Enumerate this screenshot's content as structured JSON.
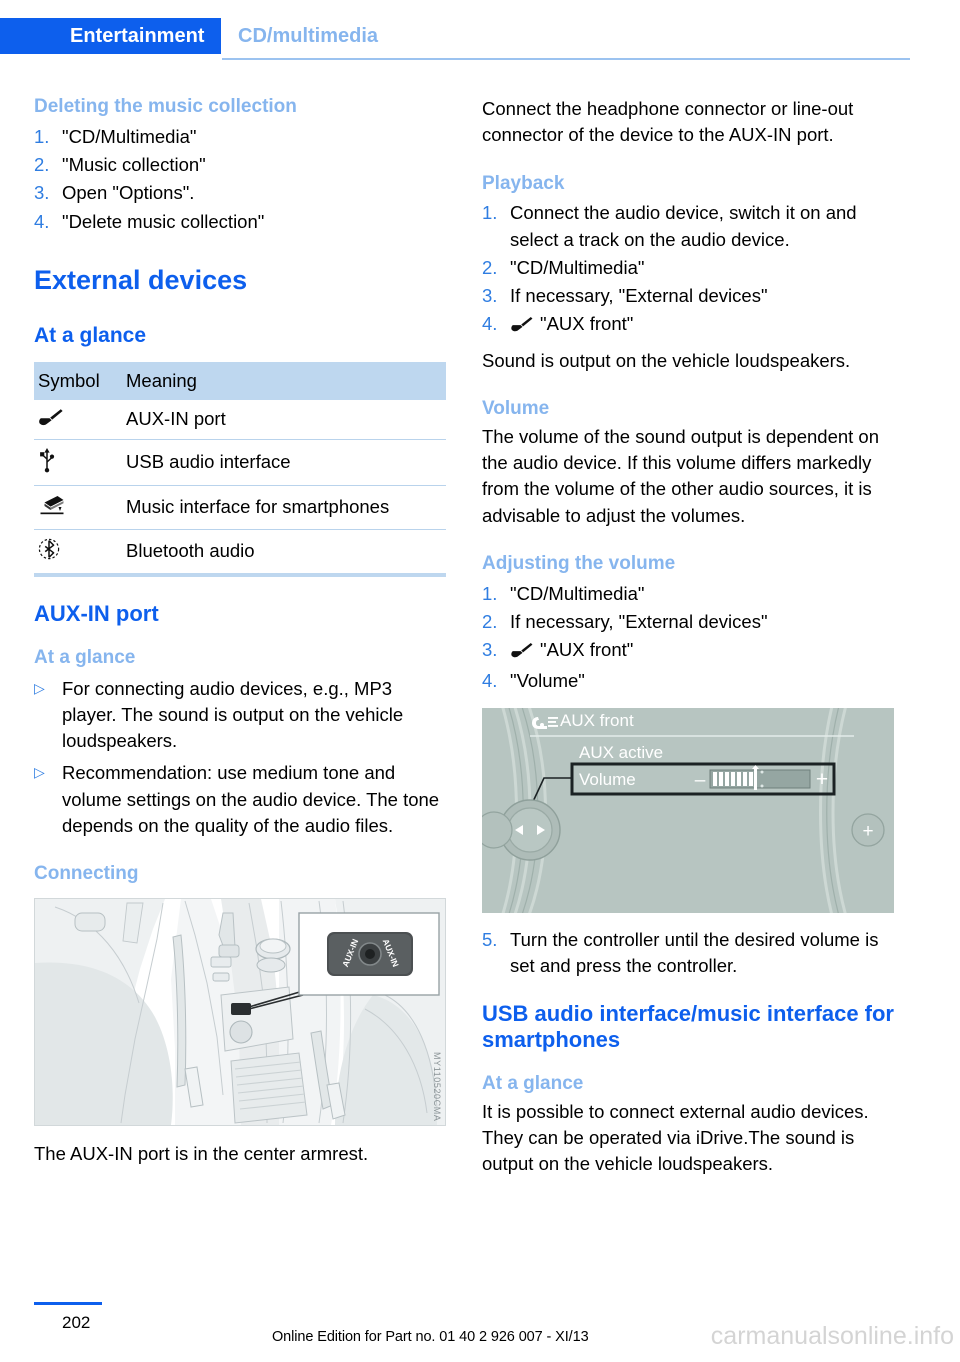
{
  "header": {
    "chapter": "Entertainment",
    "section": "CD/multimedia"
  },
  "left_column": {
    "deleting_heading": "Deleting the music collection",
    "deleting_steps": [
      {
        "num": "1.",
        "text": "\"CD/Multimedia\""
      },
      {
        "num": "2.",
        "text": "\"Music collection\""
      },
      {
        "num": "3.",
        "text": "Open \"Options\"."
      },
      {
        "num": "4.",
        "text": "\"Delete music collection\""
      }
    ],
    "external_devices_title": "External devices",
    "at_a_glance_1": "At a glance",
    "table": {
      "headers": [
        "Symbol",
        "Meaning"
      ],
      "rows": [
        {
          "icon": "aux-plug-icon",
          "meaning": "AUX-IN port"
        },
        {
          "icon": "usb-icon",
          "meaning": "USB audio interface"
        },
        {
          "icon": "snap-in-adapter-icon",
          "meaning": "Music interface for smartphones"
        },
        {
          "icon": "bluetooth-icon",
          "meaning": "Bluetooth audio"
        }
      ]
    },
    "aux_in_port_title": "AUX-IN port",
    "at_a_glance_2": "At a glance",
    "aux_bullets": [
      "For connecting audio devices, e.g., MP3 player. The sound is output on the vehicle loudspeakers.",
      "Recommendation: use medium tone and volume settings on the audio device. The tone depends on the quality of the audio files."
    ],
    "connecting_heading": "Connecting",
    "car_figure": {
      "callout_label": "AUX-IN",
      "watermark": "MY110520CMA"
    },
    "car_caption": "The AUX-IN port is in the center armrest."
  },
  "right_column": {
    "connect_paragraph": "Connect the headphone connector or line-out connector of the device to the AUX-IN port.",
    "playback_heading": "Playback",
    "playback_steps": [
      {
        "num": "1.",
        "text": "Connect the audio device, switch it on and select a track on the audio device.",
        "icon": ""
      },
      {
        "num": "2.",
        "text": "\"CD/Multimedia\"",
        "icon": ""
      },
      {
        "num": "3.",
        "text": "If necessary, \"External devices\"",
        "icon": ""
      },
      {
        "num": "4.",
        "text": "\"AUX front\"",
        "icon": "aux-plug-icon"
      }
    ],
    "sound_output_note": "Sound is output on the vehicle loudspeakers.",
    "volume_heading": "Volume",
    "volume_paragraph": "The volume of the sound output is dependent on the audio device. If this volume differs markedly from the volume of the other audio sources, it is advisable to adjust the volumes.",
    "adjusting_heading": "Adjusting the volume",
    "adjusting_steps": [
      {
        "num": "1.",
        "text": "\"CD/Multimedia\"",
        "icon": ""
      },
      {
        "num": "2.",
        "text": "If necessary, \"External devices\"",
        "icon": ""
      },
      {
        "num": "3.",
        "text": "\"AUX front\"",
        "icon": "aux-plug-icon"
      },
      {
        "num": "4.",
        "text": "\"Volume\"",
        "icon": ""
      }
    ],
    "idrive_screen": {
      "title": "AUX front",
      "status": "AUX active",
      "row_label": "Volume",
      "minus": "–",
      "plus": "+",
      "volume_filled_bars": 7,
      "volume_total_bars": 18
    },
    "step_five": {
      "num": "5.",
      "text": "Turn the controller until the desired volume is set and press the controller."
    },
    "usb_title": "USB audio interface/music interface for smartphones",
    "at_a_glance_3": "At a glance",
    "usb_paragraph": "It is possible to connect external audio devices. They can be operated via iDrive.The sound is output on the vehicle loudspeakers."
  },
  "footer": {
    "page_number": "202",
    "edition": "Online Edition for Part no. 01 40 2 926 007 - XI/13",
    "site_watermark": "carmanualsonline.info"
  },
  "colors": {
    "brand_blue": "#0d5fed",
    "light_blue": "#86b5ee",
    "table_header_bg": "#bed7ef",
    "idrive_bg": "#b7c5c1"
  }
}
